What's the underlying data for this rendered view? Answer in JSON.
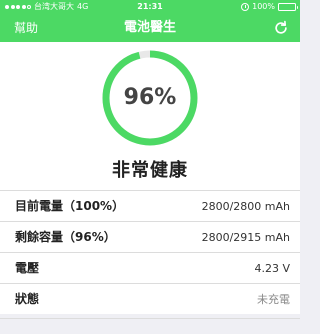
{
  "status_bar": {
    "carrier": "台湾大哥大",
    "network": "4G",
    "time": "21:31",
    "battery_text": "100%",
    "signal_bars": 4,
    "signal_total": 5
  },
  "nav": {
    "help_label": "幫助",
    "title": "電池醫生",
    "refresh_icon": "refresh-icon"
  },
  "gauge": {
    "percent_text": "96%",
    "percent_value": 96,
    "color": "#4cd964",
    "track_color": "#e8e8e8"
  },
  "health_text": "非常健康",
  "details": [
    {
      "label": "目前電量（100%）",
      "value": "2800/2800 mAh",
      "muted": false
    },
    {
      "label": "剩餘容量（96%）",
      "value": "2800/2915 mAh",
      "muted": false
    },
    {
      "label": "電壓",
      "value": "4.23 V",
      "muted": false
    },
    {
      "label": "狀態",
      "value": "未充電",
      "muted": true
    }
  ],
  "colors": {
    "accent": "#4cd964",
    "background": "#efeff4"
  }
}
